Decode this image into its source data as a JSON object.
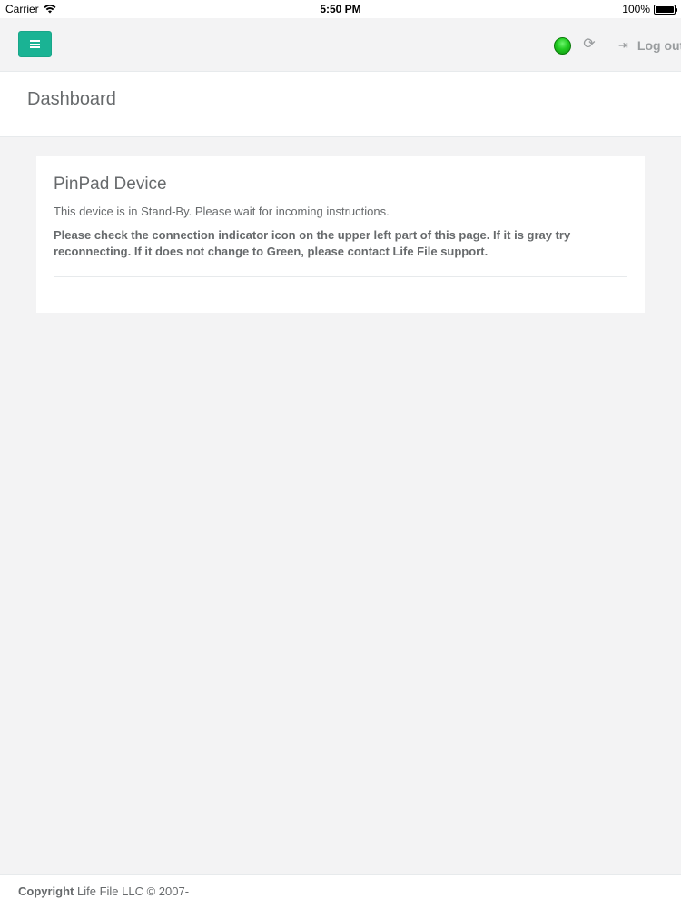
{
  "status_bar": {
    "carrier": "Carrier",
    "time": "5:50 PM",
    "battery": "100%"
  },
  "topnav": {
    "logout_label": "Log out",
    "connection_status_color": "#22cc22",
    "accent_color": "#1ab394"
  },
  "page": {
    "title": "Dashboard"
  },
  "panel": {
    "title": "PinPad Device",
    "info": "This device is in Stand-By. Please wait for incoming instructions.",
    "note": "Please check the connection indicator icon on the upper left part of this page. If it is gray try reconnecting. If it does not change to Green, please contact Life File support."
  },
  "footer": {
    "copyright_label": "Copyright",
    "copyright_text": "Life File LLC © 2007-"
  }
}
